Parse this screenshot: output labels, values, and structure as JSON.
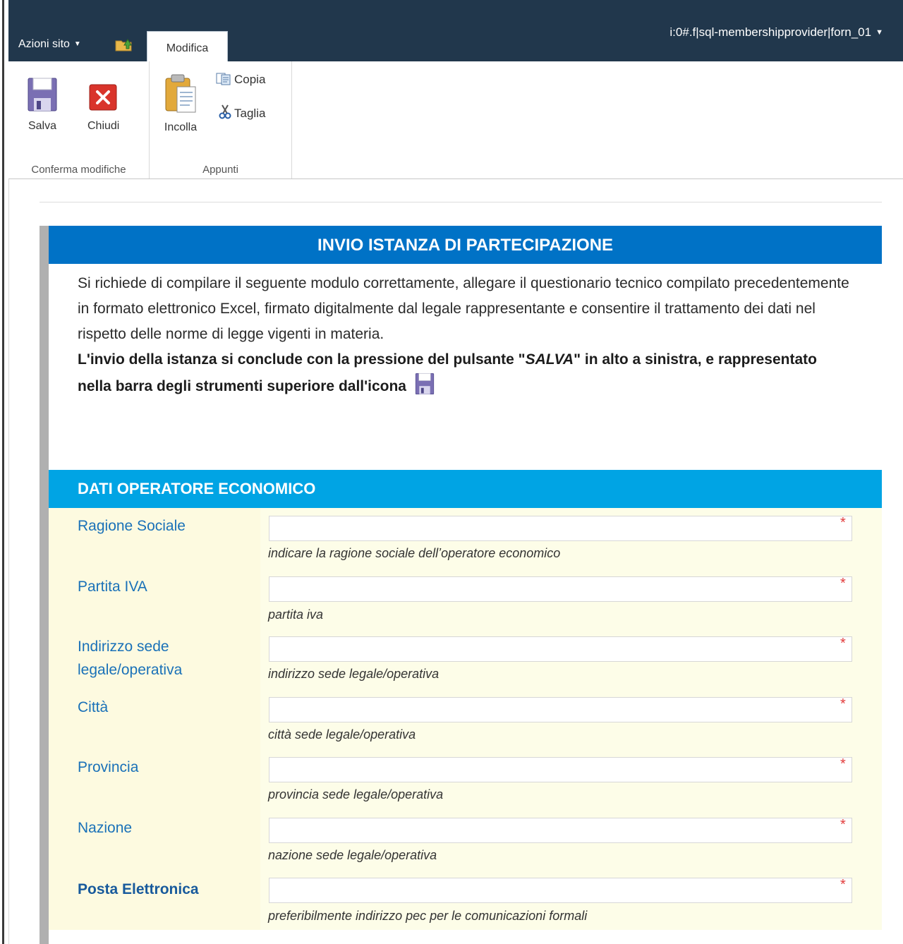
{
  "topbar": {
    "site_actions": "Azioni sito",
    "tab_label": "Modifica",
    "user": "i:0#.f|sql-membershipprovider|forn_01"
  },
  "ribbon": {
    "save": "Salva",
    "close": "Chiudi",
    "paste": "Incolla",
    "copy": "Copia",
    "cut": "Taglia",
    "group1": "Conferma modifiche",
    "group2": "Appunti"
  },
  "page": {
    "title": "INVIO ISTANZA DI PARTECIPAZIONE",
    "intro": "Si richiede di compilare il seguente modulo correttamente, allegare il questionario tecnico compilato precedentemente in formato elettronico Excel, firmato digitalmente dal legale rappresentante e consentire il trattamento dei dati nel rispetto delle norme di legge vigenti in materia.",
    "intro_bold_a": "L'invio della istanza si conclude con la pressione del pulsante \"",
    "intro_bold_salva": "SALVA",
    "intro_bold_b": "\" in alto a sinistra, e rappresentato nella barra degli strumenti superiore dall'icona",
    "section": "DATI OPERATORE ECONOMICO"
  },
  "form": {
    "required_mark": "*",
    "fields": [
      {
        "label": "Ragione Sociale",
        "value": "",
        "hint": "indicare la ragione sociale dell’operatore economico"
      },
      {
        "label": "Partita IVA",
        "value": "",
        "hint": "partita iva"
      },
      {
        "label": "Indirizzo sede legale/operativa",
        "value": "",
        "hint": "indirizzo sede legale/operativa"
      },
      {
        "label": "Città",
        "value": "",
        "hint": "città sede legale/operativa"
      },
      {
        "label": "Provincia",
        "value": "",
        "hint": "provincia sede legale/operativa"
      },
      {
        "label": "Nazione",
        "value": "",
        "hint": "nazione sede legale/operativa"
      },
      {
        "label": "Posta Elettronica",
        "value": "",
        "hint": "preferibilmente indirizzo pec per le comunicazioni formali"
      }
    ]
  },
  "colors": {
    "topbar": "#21374c",
    "title_bar": "#0072c6",
    "section_bar": "#00a4e4",
    "form_bg": "#fdfde8",
    "label_color": "#1a71b8",
    "required": "#e23b3b"
  },
  "icons": [
    "navigate-up-icon",
    "save-icon",
    "close-icon",
    "paste-icon",
    "copy-icon",
    "cut-icon"
  ]
}
